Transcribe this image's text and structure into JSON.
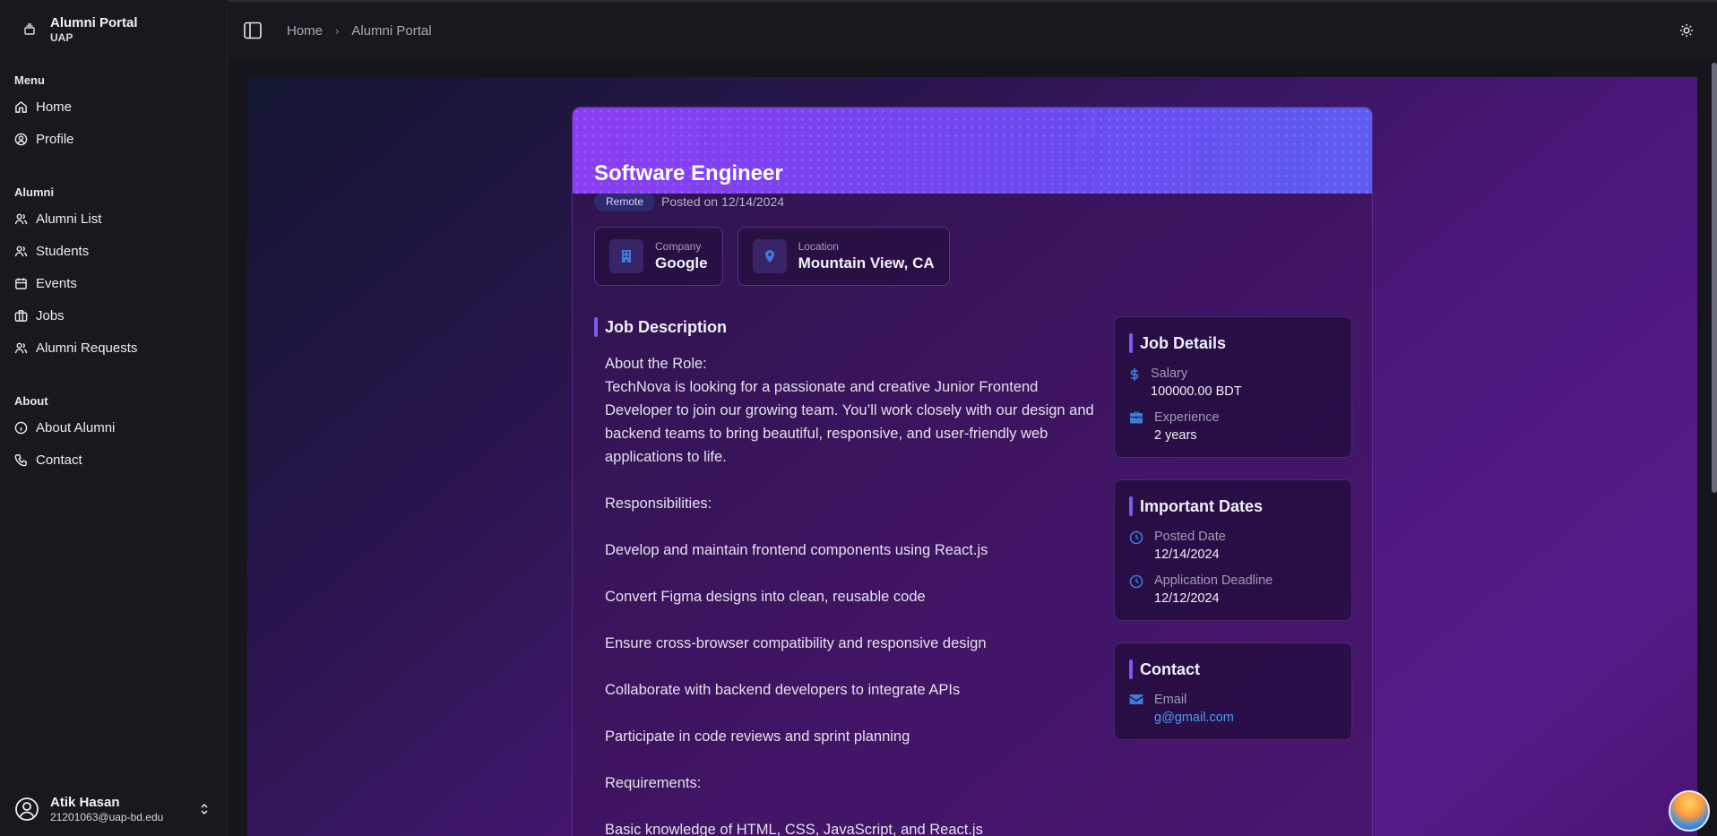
{
  "brand": {
    "title": "Alumni Portal",
    "subtitle": "UAP"
  },
  "sidebar": {
    "sections": [
      {
        "label": "Menu",
        "items": [
          {
            "label": "Home",
            "icon": "home-icon"
          },
          {
            "label": "Profile",
            "icon": "user-circle-icon"
          }
        ]
      },
      {
        "label": "Alumni",
        "items": [
          {
            "label": "Alumni List",
            "icon": "users-icon"
          },
          {
            "label": "Students",
            "icon": "users-icon"
          },
          {
            "label": "Events",
            "icon": "calendar-icon"
          },
          {
            "label": "Jobs",
            "icon": "briefcase-icon"
          },
          {
            "label": "Alumni Requests",
            "icon": "users-icon"
          }
        ]
      },
      {
        "label": "About",
        "items": [
          {
            "label": "About Alumni",
            "icon": "info-icon"
          },
          {
            "label": "Contact",
            "icon": "phone-icon"
          }
        ]
      }
    ],
    "user": {
      "name": "Atik Hasan",
      "email": "21201063@uap-bd.edu"
    }
  },
  "header": {
    "breadcrumb": [
      "Home",
      "Alumni Portal"
    ]
  },
  "job": {
    "title": "Software Engineer",
    "badge": "Remote",
    "posted": "Posted on 12/14/2024",
    "company_label": "Company",
    "company": "Google",
    "location_label": "Location",
    "location": "Mountain View, CA",
    "description_heading": "Job Description",
    "description": "About the Role:\nTechNova is looking for a passionate and creative Junior Frontend Developer to join our growing team. You’ll work closely with our design and backend teams to bring beautiful, responsive, and user-friendly web applications to life.\n\nResponsibilities:\n\nDevelop and maintain frontend components using React.js\n\nConvert Figma designs into clean, reusable code\n\nEnsure cross-browser compatibility and responsive design\n\nCollaborate with backend developers to integrate APIs\n\nParticipate in code reviews and sprint planning\n\nRequirements:\n\nBasic knowledge of HTML, CSS, JavaScript, and React.js",
    "details": {
      "title": "Job Details",
      "salary_label": "Salary",
      "salary": "100000.00 BDT",
      "experience_label": "Experience",
      "experience": "2 years"
    },
    "dates": {
      "title": "Important Dates",
      "posted_label": "Posted Date",
      "posted": "12/14/2024",
      "deadline_label": "Application Deadline",
      "deadline": "12/12/2024"
    },
    "contact": {
      "title": "Contact",
      "email_label": "Email",
      "email": "g@gmail.com"
    }
  },
  "colors": {
    "accent": "#7a5cf0",
    "link": "#4a9bf5",
    "icon_blue": "#3d7bd8"
  }
}
